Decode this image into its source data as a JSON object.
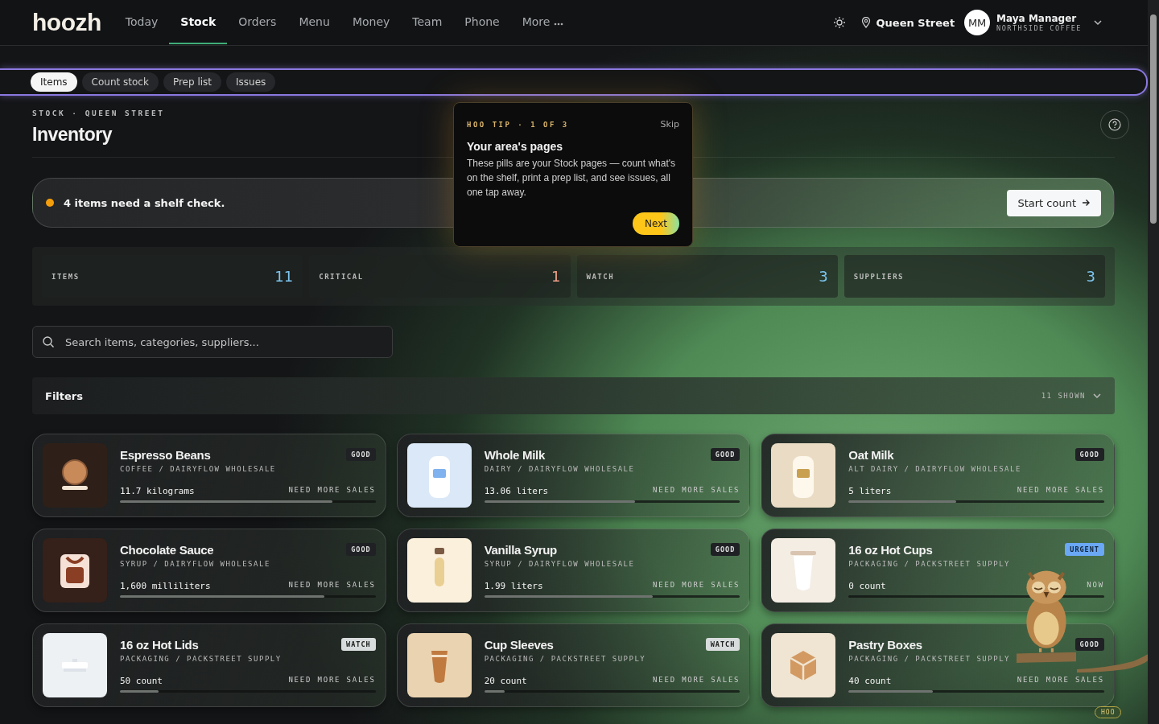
{
  "nav": {
    "logo": "hoozh",
    "tabs": [
      {
        "label": "Today",
        "selected": false
      },
      {
        "label": "Stock",
        "selected": true
      },
      {
        "label": "Orders",
        "selected": false
      },
      {
        "label": "Menu",
        "selected": false
      },
      {
        "label": "Money",
        "selected": false
      },
      {
        "label": "Team",
        "selected": false
      },
      {
        "label": "Phone",
        "selected": false
      },
      {
        "label": "More",
        "selected": false
      }
    ],
    "location": "Queen Street",
    "user": {
      "initials": "MM",
      "name": "Maya Manager",
      "org": "NORTHSIDE COFFEE"
    }
  },
  "subtabs": [
    {
      "label": "Items",
      "selected": true
    },
    {
      "label": "Count stock",
      "selected": false
    },
    {
      "label": "Prep list",
      "selected": false
    },
    {
      "label": "Issues",
      "selected": false
    }
  ],
  "header": {
    "breadcrumb": "STOCK · QUEEN STREET",
    "title": "Inventory"
  },
  "banner": {
    "text": "4 items need a shelf check.",
    "color": "#f59e0b",
    "button": "Start count"
  },
  "stats": [
    {
      "label": "ITEMS",
      "value": "11",
      "color": "#7cc4f0"
    },
    {
      "label": "CRITICAL",
      "value": "1",
      "color": "#f0a08a"
    },
    {
      "label": "WATCH",
      "value": "3",
      "color": "#7cc4f0"
    },
    {
      "label": "SUPPLIERS",
      "value": "3",
      "color": "#7cc4f0"
    }
  ],
  "search": {
    "placeholder": "Search items, categories, suppliers..."
  },
  "filters": {
    "title": "Filters",
    "count": "11 SHOWN"
  },
  "items": [
    {
      "name": "Espresso Beans",
      "meta": "COFFEE / DAIRYFLOW WHOLESALE",
      "qty": "11.7 kilograms",
      "action": "NEED MORE SALES",
      "status": "GOOD",
      "kind": "beans",
      "level": 0.83
    },
    {
      "name": "Whole Milk",
      "meta": "DAIRY / DAIRYFLOW WHOLESALE",
      "qty": "13.06 liters",
      "action": "NEED MORE SALES",
      "status": "GOOD",
      "kind": "milk",
      "level": 0.59
    },
    {
      "name": "Oat Milk",
      "meta": "ALT DAIRY / DAIRYFLOW WHOLESALE",
      "qty": "5 liters",
      "action": "NEED MORE SALES",
      "status": "GOOD",
      "kind": "oat",
      "level": 0.42
    },
    {
      "name": "Chocolate Sauce",
      "meta": "SYRUP / DAIRYFLOW WHOLESALE",
      "qty": "1,600 milliliters",
      "action": "NEED MORE SALES",
      "status": "GOOD",
      "kind": "sauce",
      "level": 0.8
    },
    {
      "name": "Vanilla Syrup",
      "meta": "SYRUP / DAIRYFLOW WHOLESALE",
      "qty": "1.99 liters",
      "action": "NEED MORE SALES",
      "status": "GOOD",
      "kind": "syrup",
      "level": 0.66
    },
    {
      "name": "16 oz Hot Cups",
      "meta": "PACKAGING / PACKSTREET SUPPLY",
      "qty": "0 count",
      "action": "NOW",
      "status": "URGENT",
      "kind": "cup",
      "level": 0
    },
    {
      "name": "16 oz Hot Lids",
      "meta": "PACKAGING / PACKSTREET SUPPLY",
      "qty": "50 count",
      "action": "NEED MORE SALES",
      "status": "WATCH",
      "kind": "lid",
      "level": 0.15
    },
    {
      "name": "Cup Sleeves",
      "meta": "PACKAGING / PACKSTREET SUPPLY",
      "qty": "20 count",
      "action": "NEED MORE SALES",
      "status": "WATCH",
      "kind": "sleeve",
      "level": 0.08
    },
    {
      "name": "Pastry Boxes",
      "meta": "PACKAGING / PACKSTREET SUPPLY",
      "qty": "40 count",
      "action": "NEED MORE SALES",
      "status": "GOOD",
      "kind": "box",
      "level": 0.33
    }
  ],
  "tip": {
    "eyebrow": "HOO TIP · 1 OF 3",
    "skip": "Skip",
    "title": "Your area's pages",
    "body": "These pills are your Stock pages — count what's on the shelf, print a prep list, and see issues, all one tap away.",
    "button": "Next"
  },
  "mascot": {
    "badge": "HOO"
  }
}
